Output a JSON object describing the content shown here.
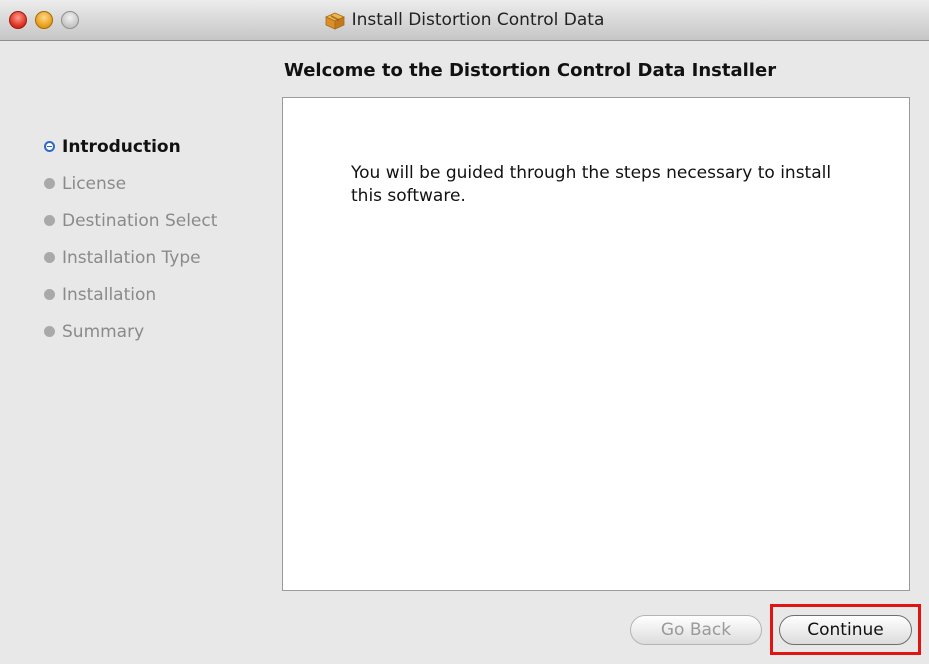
{
  "window": {
    "title": "Install Distortion Control Data"
  },
  "main": {
    "heading": "Welcome to the Distortion Control Data Installer",
    "body_text": "You will be guided through the steps necessary to install this software."
  },
  "sidebar": {
    "steps": [
      {
        "label": "Introduction",
        "state": "active"
      },
      {
        "label": "License",
        "state": "pending"
      },
      {
        "label": "Destination Select",
        "state": "pending"
      },
      {
        "label": "Installation Type",
        "state": "pending"
      },
      {
        "label": "Installation",
        "state": "pending"
      },
      {
        "label": "Summary",
        "state": "pending"
      }
    ]
  },
  "buttons": {
    "go_back": {
      "label": "Go Back",
      "enabled": false
    },
    "continue": {
      "label": "Continue",
      "enabled": true
    }
  },
  "colors": {
    "accent": "#2e67c8",
    "highlight": "#e11414"
  },
  "icons": {
    "title_icon": "package-icon"
  }
}
